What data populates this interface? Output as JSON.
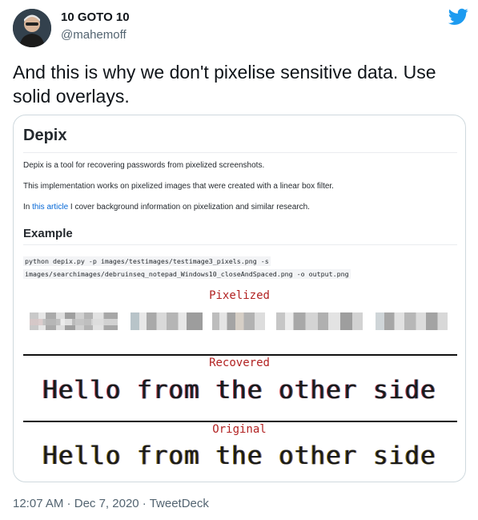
{
  "author": {
    "name": "10 GOTO 10",
    "handle": "@mahemoff"
  },
  "tweet_text": "And this is why we don't pixelise sensitive data. Use solid overlays.",
  "card": {
    "title": "Depix",
    "para1": "Depix is a tool for recovering passwords from pixelized screenshots.",
    "para2": "This implementation works on pixelized images that were created with a linear box filter.",
    "para3_prefix": "In ",
    "para3_link": "this article",
    "para3_suffix": " I cover background information on pixelization and similar research.",
    "example_heading": "Example",
    "code_line1": "python depix.py -p images/testimages/testimage3_pixels.png -s",
    "code_line2": "images/searchimages/debruinseq_notepad_Windows10_closeAndSpaced.png -o output.png",
    "label_pixelized": "Pixelized",
    "label_recovered": "Recovered",
    "label_original": "Original",
    "recovered_text": "Hello from the other side",
    "original_text": "Hello from the other side"
  },
  "meta": {
    "time": "12:07 AM",
    "sep1": " · ",
    "date": "Dec 7, 2020",
    "sep2": " · ",
    "source": "TweetDeck"
  },
  "colors": {
    "twitter_blue": "#1d9bf0",
    "label_red": "#b22222",
    "link_blue": "#0366d6"
  },
  "icons": {
    "logo": "twitter-bird-icon"
  }
}
